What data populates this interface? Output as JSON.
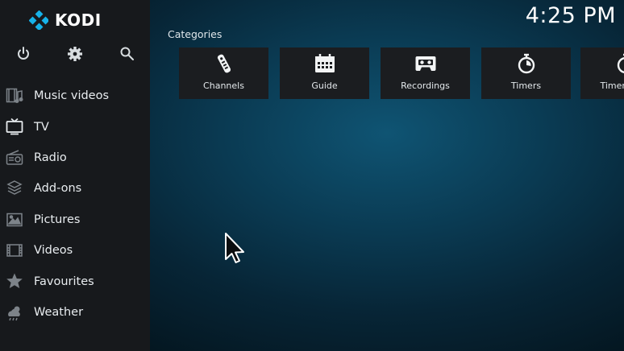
{
  "app": {
    "logo_text": "KODI"
  },
  "clock": {
    "time": "4:25 PM"
  },
  "top_icons": [
    "power-icon",
    "gear-icon",
    "search-icon"
  ],
  "sidebar": {
    "items": [
      {
        "label": "Music videos",
        "icon": "music-video-icon"
      },
      {
        "label": "TV",
        "icon": "tv-icon"
      },
      {
        "label": "Radio",
        "icon": "radio-icon"
      },
      {
        "label": "Add-ons",
        "icon": "addons-icon"
      },
      {
        "label": "Pictures",
        "icon": "pictures-icon"
      },
      {
        "label": "Videos",
        "icon": "videos-icon"
      },
      {
        "label": "Favourites",
        "icon": "star-icon"
      },
      {
        "label": "Weather",
        "icon": "weather-icon"
      }
    ]
  },
  "main": {
    "section_label": "Categories",
    "tiles": [
      {
        "label": "Channels",
        "icon": "remote-icon"
      },
      {
        "label": "Guide",
        "icon": "calendar-icon"
      },
      {
        "label": "Recordings",
        "icon": "cassette-icon"
      },
      {
        "label": "Timers",
        "icon": "stopwatch-icon"
      },
      {
        "label": "Timer rules",
        "icon": "stopwatch-icon"
      }
    ]
  },
  "colors": {
    "sidebar_bg": "#17191c",
    "tile_bg": "#1b1d20",
    "accent": "#12a8e0",
    "background": "#0a3a52"
  }
}
